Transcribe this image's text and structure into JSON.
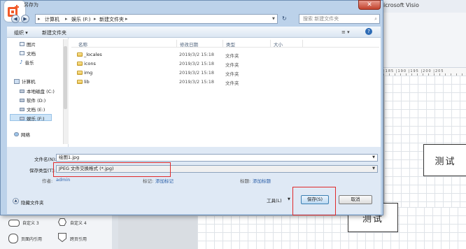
{
  "background": {
    "visio_title": "icrosoft Visio",
    "ruler_numbers": "|185 |190 |195 |200 |205",
    "box_labels": [
      "测试",
      "测试"
    ],
    "shapes": [
      {
        "label": "自定义 3"
      },
      {
        "label": "自定义 4"
      },
      {
        "label": "页面内引用"
      },
      {
        "label": "跨页引用"
      }
    ]
  },
  "dialog": {
    "title": "另存为",
    "close_symbol": "✕",
    "address": {
      "crumbs": [
        "计算机",
        "娱乐 (F:)",
        "新建文件夹"
      ],
      "refresh_symbol": "↻"
    },
    "search_placeholder": "搜索 新建文件夹",
    "toolbar": {
      "organize": "组织 ▾",
      "new_folder": "新建文件夹",
      "view_symbol": "≡ ▾",
      "help_symbol": "?"
    },
    "nav": {
      "items": [
        {
          "label": "图片"
        },
        {
          "label": "文档"
        },
        {
          "label": "音乐"
        },
        {
          "label": "计算机"
        },
        {
          "label": "本地磁盘 (C:)"
        },
        {
          "label": "软件 (D:)"
        },
        {
          "label": "文档 (E:)"
        },
        {
          "label": "娱乐 (F:)"
        },
        {
          "label": "网络"
        }
      ]
    },
    "columns": [
      "名称",
      "修改日期",
      "类型",
      "大小"
    ],
    "files": [
      {
        "name": "_locales",
        "date": "2019/3/2 15:18",
        "type": "文件夹"
      },
      {
        "name": "icons",
        "date": "2019/3/2 15:18",
        "type": "文件夹"
      },
      {
        "name": "img",
        "date": "2019/3/2 15:18",
        "type": "文件夹"
      },
      {
        "name": "lib",
        "date": "2019/3/2 15:18",
        "type": "文件夹"
      }
    ],
    "filename_label": "文件名(N):",
    "filename_value": "绘图1.jpg",
    "savetype_label": "保存类型(T):",
    "savetype_value": "JPEG 文件交换格式 (*.jpg)",
    "author_label": "作者:",
    "author_value": "admin",
    "tag_label": "标记:",
    "tag_value": "添加标记",
    "title_label": "标题:",
    "title_value": "添加标题",
    "hide_folders": "隐藏文件夹",
    "tools_label": "工具(L)",
    "save_label": "保存(S)",
    "cancel_label": "取消",
    "highlight_color": "#e02a2a"
  }
}
